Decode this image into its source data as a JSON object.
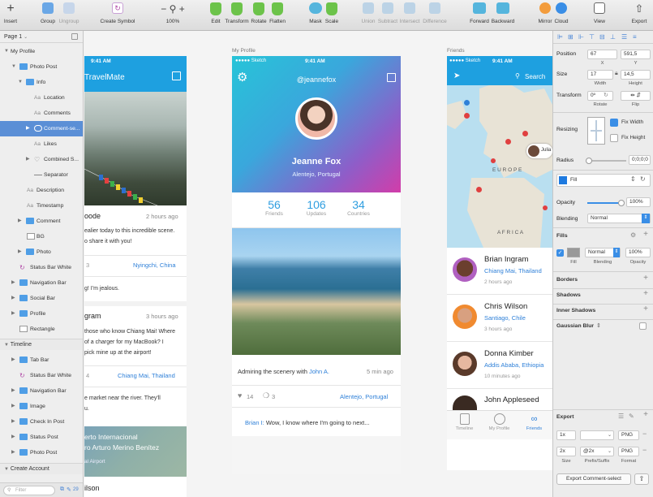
{
  "toolbar": {
    "insert": "Insert",
    "group": "Group",
    "ungroup": "Ungroup",
    "create_symbol": "Create Symbol",
    "zoom": "100%",
    "edit": "Edit",
    "transform": "Transform",
    "rotate": "Rotate",
    "flatten": "Flatten",
    "mask": "Mask",
    "scale": "Scale",
    "union": "Union",
    "subtract": "Subtract",
    "intersect": "Intersect",
    "difference": "Difference",
    "forward": "Forward",
    "backward": "Backward",
    "mirror": "Mirror",
    "cloud": "Cloud",
    "view": "View",
    "export": "Export"
  },
  "layers": {
    "page": "Page 1",
    "artboard1": "My Profile",
    "items": [
      {
        "label": "Photo Post"
      },
      {
        "label": "Info"
      },
      {
        "label": "Location"
      },
      {
        "label": "Comments"
      },
      {
        "label": "Comment-se..."
      },
      {
        "label": "Likes"
      },
      {
        "label": "Combined S..."
      },
      {
        "label": "Separator"
      },
      {
        "label": "Description"
      },
      {
        "label": "Timestamp"
      },
      {
        "label": "Comment"
      },
      {
        "label": "BG"
      },
      {
        "label": "Photo"
      },
      {
        "label": "Status Bar White"
      },
      {
        "label": "Navigation Bar"
      },
      {
        "label": "Social Bar"
      },
      {
        "label": "Profile"
      },
      {
        "label": "Rectangle"
      }
    ],
    "artboard2": "Timeline",
    "items2": [
      {
        "label": "Tab Bar"
      },
      {
        "label": "Status Bar White"
      },
      {
        "label": "Navigation Bar"
      },
      {
        "label": "Image"
      },
      {
        "label": "Check In Post"
      },
      {
        "label": "Status Post"
      },
      {
        "label": "Photo Post"
      }
    ],
    "artboard3": "Create Account",
    "filter_placeholder": "Filter",
    "count": "29"
  },
  "canvas": {
    "label_profile": "My Profile",
    "label_friends": "Friends",
    "travelmate": {
      "time": "9:41 AM",
      "title": "TravelMate",
      "post1_user_fragment": "oode",
      "post1_time": "2 hours ago",
      "post1_text1": "ealier today to this incredible scene.",
      "post1_text2": "o share it with you!",
      "post1_comments": "3",
      "post1_location": "Nyingchi, China",
      "post1_reply": "g! I'm jealous.",
      "post2_user_fragment": "gram",
      "post2_time": "3 hours ago",
      "post2_text1": "those who know Chiang Mai! Where",
      "post2_text2": "of a charger for my MacBook? I",
      "post2_text3": "pick mine up at the airport!",
      "post2_comments": "4",
      "post2_location": "Chiang Mai, Thailand",
      "post2_reply1": "e market near the river. They'll",
      "post2_reply2": "u.",
      "card_title1": "erto Internacional",
      "card_title2": "ro Arturo Merino Benítez",
      "card_sub": "al Airport",
      "bottom_name": "ilson"
    },
    "profile": {
      "carrier": "●●●●● Sketch",
      "time": "9:41 AM",
      "handle": "@jeannefox",
      "name": "Jeanne Fox",
      "location": "Alentejo, Portugal",
      "stats": [
        {
          "value": "56",
          "label": "Friends"
        },
        {
          "value": "106",
          "label": "Updates"
        },
        {
          "value": "34",
          "label": "Countries"
        }
      ],
      "caption_prefix": "Admiring the scenery with",
      "caption_mention": "John A.",
      "caption_time": "5 min ago",
      "likes": "14",
      "comments": "3",
      "comment_user": "Brian I:",
      "comment_text": "Wow, I know where I'm going to next..."
    },
    "friends": {
      "carrier": "●●●●● Sketch",
      "time": "9:41 AM",
      "search": "Search",
      "map_europe": "E U R O P E",
      "map_africa": "A F R I C A",
      "map_pin_label": "Julia",
      "people": [
        {
          "name": "Brian Ingram",
          "place": "Chiang Mai, Thailand",
          "time": "2 hours ago"
        },
        {
          "name": "Chris Wilson",
          "place": "Santiago, Chile",
          "time": "3 hours ago"
        },
        {
          "name": "Donna Kimber",
          "place": "Addis Ababa, Ethiopia",
          "time": "10 minutes ago"
        },
        {
          "name": "John Appleseed",
          "place": "",
          "time": ""
        }
      ],
      "tabs": [
        "Timeline",
        "My Profile",
        "Friends"
      ]
    }
  },
  "inspector": {
    "position": "Position",
    "x": "67",
    "y": "591,5",
    "x_label": "X",
    "y_label": "Y",
    "size": "Size",
    "width": "17",
    "height": "14,5",
    "width_label": "Width",
    "height_label": "Height",
    "transform": "Transform",
    "rotate_value": "0º",
    "rotate_label": "Rotate",
    "flip_label": "Flip",
    "resizing": "Resizing",
    "fix_width": "Fix Width",
    "fix_height": "Fix Height",
    "radius": "Radius",
    "radius_value": "0;0;0;0",
    "fill_style": "Fill",
    "opacity": "Opacity",
    "opacity_value": "100%",
    "blending": "Blending",
    "blending_value": "Normal",
    "fills": "Fills",
    "fill_blend": "Normal",
    "fill_opacity": "100%",
    "fill_label": "Fill",
    "fill_blend_label": "Blending",
    "fill_opacity_label": "Opacity",
    "borders": "Borders",
    "shadows": "Shadows",
    "inner_shadows": "Inner Shadows",
    "gaussian_blur": "Gaussian Blur",
    "export": "Export",
    "export_rows": [
      {
        "size": "1x",
        "suffix": "",
        "format": "PNG"
      },
      {
        "size": "2x",
        "suffix": "@2x",
        "format": "PNG"
      }
    ],
    "size_label": "Size",
    "prefix_label": "Prefix/Suffix",
    "format_label": "Format",
    "export_button": "Export Comment-select"
  },
  "colors": {
    "accent": "#2f80d8",
    "cyan": "#24c6dc",
    "magenta": "#d83cb0",
    "selection": "#5b8fd6"
  }
}
